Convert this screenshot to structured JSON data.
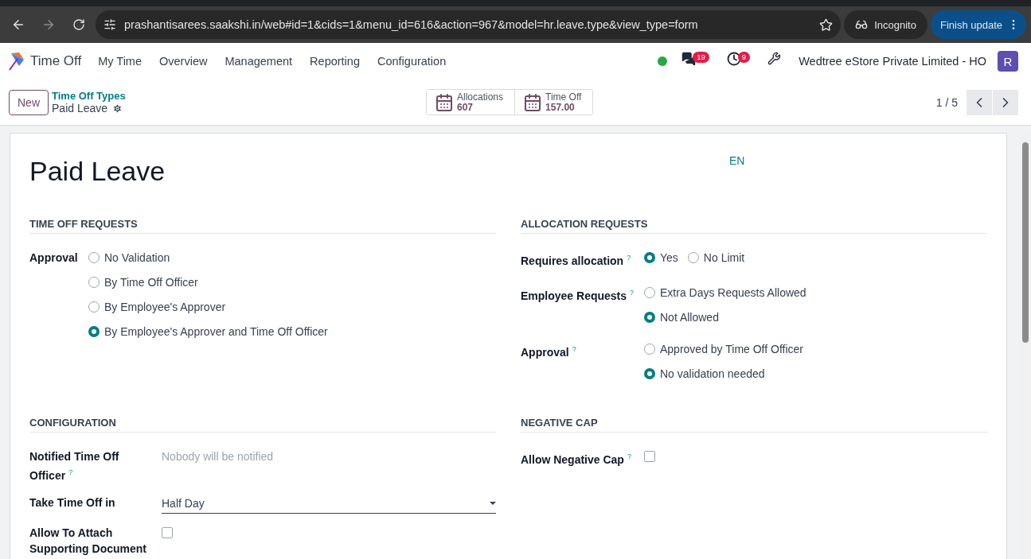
{
  "browser": {
    "url": "prashantisarees.saakshi.in/web#id=1&cids=1&menu_id=616&action=967&model=hr.leave.type&view_type=form",
    "incognito": "Incognito",
    "update_button": "Finish update"
  },
  "navbar": {
    "app_name": "Time Off",
    "menu": [
      "My Time",
      "Overview",
      "Management",
      "Reporting",
      "Configuration"
    ],
    "online": true,
    "messages_count": "19",
    "activities_count": "9",
    "company": "Wedtree eStore Private Limited - HO",
    "avatar": "R"
  },
  "control_panel": {
    "new_button": "New",
    "breadcrumb": "Time Off Types",
    "record": "Paid Leave",
    "stats": [
      {
        "label": "Allocations",
        "value": "607"
      },
      {
        "label": "Time Off",
        "value": "157.00"
      }
    ],
    "pager": "1 / 5"
  },
  "form": {
    "title": "Paid Leave",
    "language": "EN",
    "sections": [
      {
        "title": "TIME OFF REQUESTS",
        "fields": [
          {
            "kind": "radio",
            "label": "Approval",
            "options": [
              {
                "label": "No Validation",
                "selected": false
              },
              {
                "label": "By Time Off Officer",
                "selected": false
              },
              {
                "label": "By Employee's Approver",
                "selected": false
              },
              {
                "label": "By Employee's Approver and Time Off Officer",
                "selected": true
              }
            ]
          }
        ]
      },
      {
        "title": "ALLOCATION REQUESTS",
        "fields": [
          {
            "kind": "radio_inline",
            "label": "Requires allocation",
            "help": "?",
            "options": [
              {
                "label": "Yes",
                "selected": true
              },
              {
                "label": "No Limit",
                "selected": false
              }
            ]
          },
          {
            "kind": "radio",
            "label": "Employee Requests",
            "help": "?",
            "options": [
              {
                "label": "Extra Days Requests Allowed",
                "selected": false
              },
              {
                "label": "Not Allowed",
                "selected": true
              }
            ]
          },
          {
            "kind": "radio",
            "label": "Approval",
            "help": "?",
            "options": [
              {
                "label": "Approved by Time Off Officer",
                "selected": false
              },
              {
                "label": "No validation needed",
                "selected": true
              }
            ]
          }
        ]
      },
      {
        "title": "CONFIGURATION",
        "fields": [
          {
            "kind": "text",
            "label": "Notified Time Off Officer",
            "help": "?",
            "placeholder": "Nobody will be notified"
          },
          {
            "kind": "select",
            "label": "Take Time Off in",
            "value": "Half Day"
          },
          {
            "kind": "checkbox",
            "label": "Allow To Attach Supporting Document",
            "checked": false
          }
        ]
      },
      {
        "title": "NEGATIVE CAP",
        "fields": [
          {
            "kind": "checkbox",
            "label": "Allow Negative Cap",
            "help": "?",
            "checked": false
          }
        ]
      }
    ]
  }
}
